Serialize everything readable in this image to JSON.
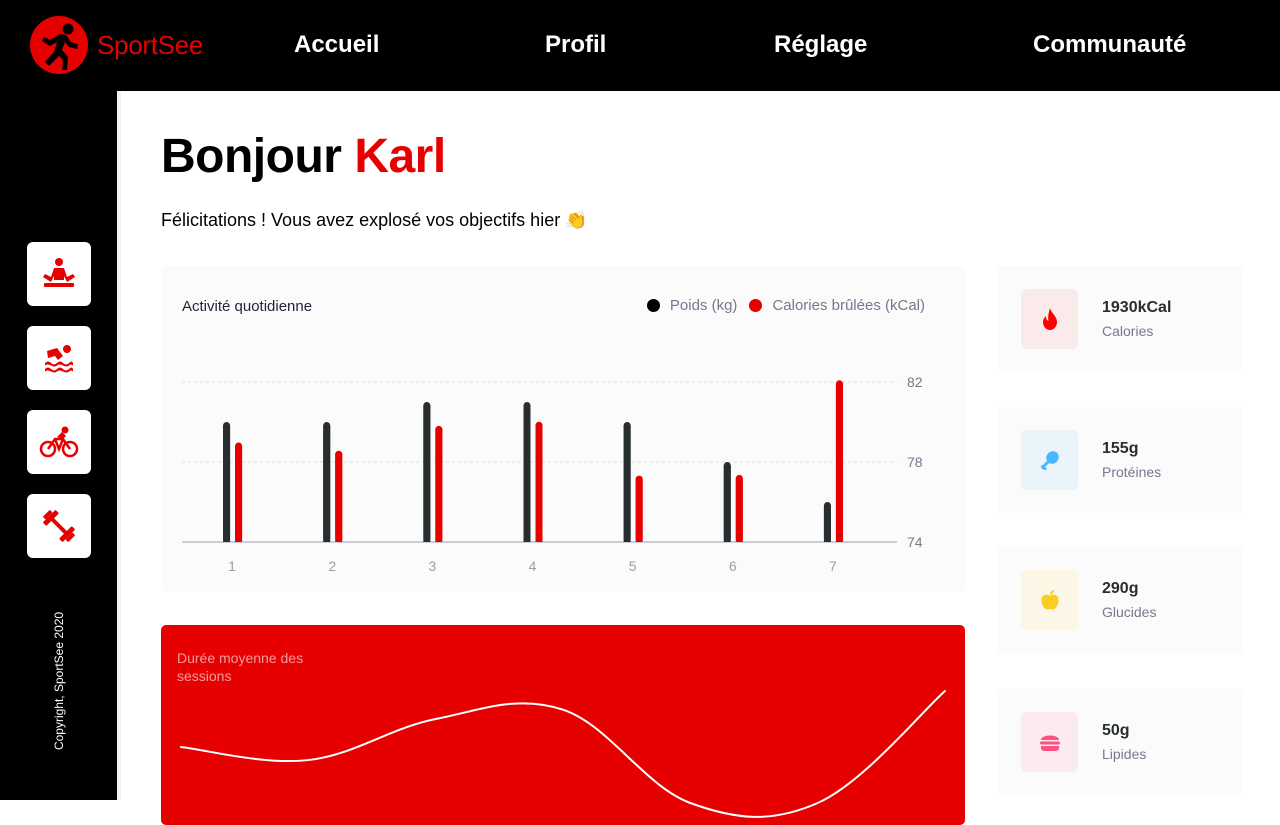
{
  "brand": {
    "name": "SportSee",
    "color": "#E60000"
  },
  "nav": {
    "items": [
      {
        "label": "Accueil"
      },
      {
        "label": "Profil"
      },
      {
        "label": "Réglage"
      },
      {
        "label": "Communauté"
      }
    ]
  },
  "sidebar": {
    "items": [
      {
        "icon": "yoga-icon"
      },
      {
        "icon": "swimming-icon"
      },
      {
        "icon": "cycling-icon"
      },
      {
        "icon": "dumbbell-icon"
      }
    ],
    "copyright": "Copyright, SportSee 2020"
  },
  "header": {
    "greeting": "Bonjour",
    "first_name": "Karl",
    "message": "Félicitations ! Vous avez explosé vos objectifs hier 👏"
  },
  "activity": {
    "title": "Activité quotidienne",
    "legend": {
      "weight": "Poids (kg)",
      "calories": "Calories brûlées (kCal)"
    }
  },
  "sessions": {
    "title": "Durée moyenne des sessions"
  },
  "key_data": [
    {
      "value": "1930kCal",
      "label": "Calories",
      "icon": "fire-icon",
      "bg": "#FBEAEA",
      "color": "#FF0000"
    },
    {
      "value": "155g",
      "label": "Protéines",
      "icon": "chicken-icon",
      "bg": "#E9F4FB",
      "color": "#4AB8FF"
    },
    {
      "value": "290g",
      "label": "Glucides",
      "icon": "apple-icon",
      "bg": "#FBF6E5",
      "color": "#F9CE23"
    },
    {
      "value": "50g",
      "label": "Lipides",
      "icon": "burger-icon",
      "bg": "#FBEAEF",
      "color": "#FD5181"
    }
  ],
  "chart_data": [
    {
      "type": "bar",
      "categories": [
        "1",
        "2",
        "3",
        "4",
        "5",
        "6",
        "7"
      ],
      "series": [
        {
          "name": "Poids (kg)",
          "color": "#282D30",
          "values": [
            80,
            80,
            81,
            81,
            80,
            78,
            76
          ]
        },
        {
          "name": "Calories brûlées (kCal)",
          "color": "#E60000",
          "values": [
            240,
            220,
            280,
            290,
            160,
            162,
            390
          ]
        }
      ],
      "y_ticks": [
        "74",
        "78",
        "82"
      ],
      "ylim": [
        74,
        82
      ],
      "grid": true,
      "legend_position": "top-right"
    },
    {
      "type": "line",
      "x": [
        1,
        2,
        3,
        4,
        5,
        6,
        7
      ],
      "values": [
        30,
        23,
        45,
        50,
        0,
        0,
        60
      ]
    }
  ]
}
